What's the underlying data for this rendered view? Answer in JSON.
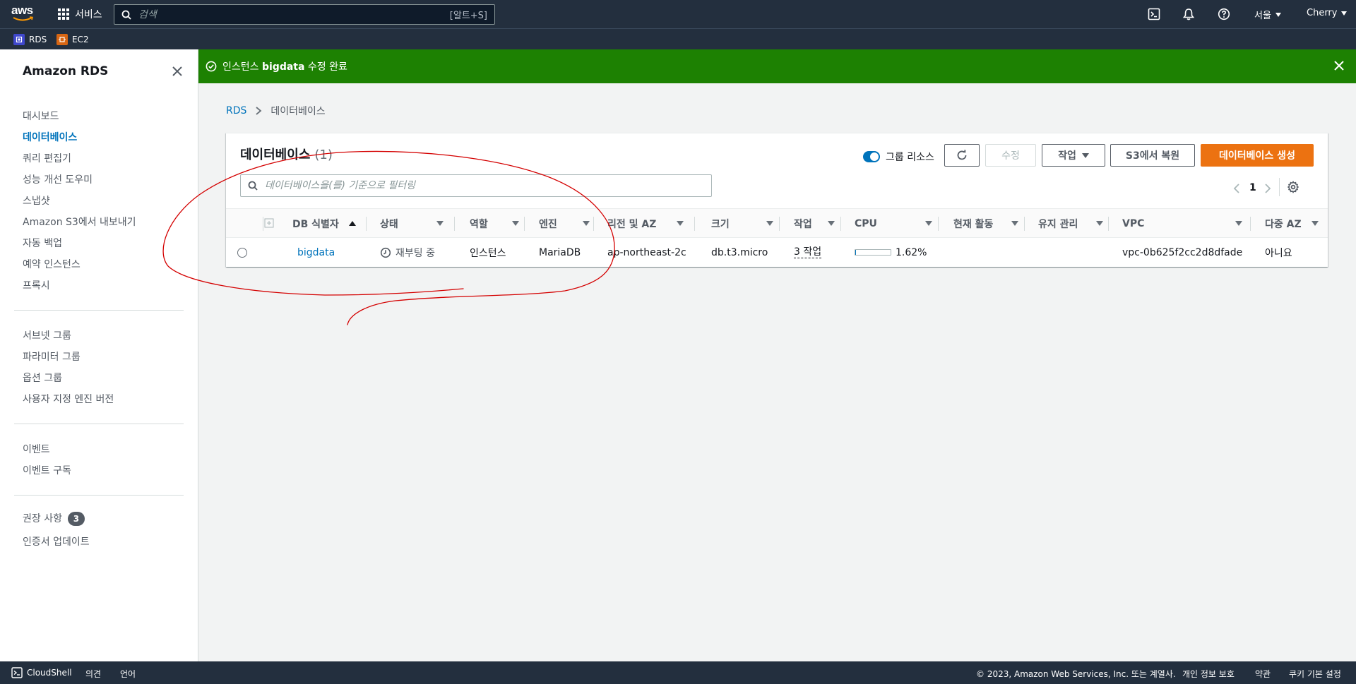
{
  "topnav": {
    "logo_text": "aws",
    "services_label": "서비스",
    "search_placeholder": "검색",
    "search_shortcut": "[알트+S]",
    "region_label": "서울",
    "user_label": "Cherry"
  },
  "favorites": [
    {
      "label": "RDS",
      "color": "#3f48cc"
    },
    {
      "label": "EC2",
      "color": "#d86613"
    }
  ],
  "sidebar": {
    "title": "Amazon RDS",
    "group1": [
      "대시보드",
      "데이터베이스",
      "쿼리 편집기",
      "성능 개선 도우미",
      "스냅샷",
      "Amazon S3에서 내보내기",
      "자동 백업",
      "예약 인스턴스",
      "프록시"
    ],
    "active_item": "데이터베이스",
    "group2": [
      "서브넷 그룹",
      "파라미터 그룹",
      "옵션 그룹",
      "사용자 지정 엔진 버전"
    ],
    "group3": [
      "이벤트",
      "이벤트 구독"
    ],
    "group4": [
      "권장 사항",
      "인증서 업데이트"
    ],
    "recommendations_badge": "3"
  },
  "flash": {
    "prefix": "인스턴스 ",
    "bold": "bigdata",
    "suffix": " 수정 완료",
    "color": "#1d8102"
  },
  "breadcrumb": {
    "root": "RDS",
    "current": "데이터베이스"
  },
  "databases": {
    "title": "데이터베이스",
    "count": "(1)",
    "group_resources_label": "그룹 리소스",
    "modify_label": "수정",
    "actions_label": "작업",
    "restore_s3_label": "S3에서 복원",
    "create_label": "데이터베이스 생성",
    "filter_placeholder": "데이터베이스을(를) 기준으로 필터링",
    "page": "1",
    "columns": [
      "DB 식별자",
      "상태",
      "역할",
      "엔진",
      "리전 및 AZ",
      "크기",
      "작업",
      "CPU",
      "현재 활동",
      "유지 관리",
      "VPC",
      "다중 AZ"
    ],
    "rows": [
      {
        "identifier": "bigdata",
        "status": "재부팅 중",
        "role": "인스턴스",
        "engine": "MariaDB",
        "region_az": "ap-northeast-2c",
        "size": "db.t3.micro",
        "actions": "3 작업",
        "cpu": "1.62%",
        "cpu_fraction": 0.0162,
        "activity": "",
        "maintenance": "",
        "vpc": "vpc-0b625f2cc2d8dfade",
        "multi_az": "아니요"
      }
    ]
  },
  "footer": {
    "cloudshell": "CloudShell",
    "feedback": "의견",
    "language": "언어",
    "copyright": "© 2023, Amazon Web Services, Inc. 또는 계열사.",
    "privacy": "개인 정보 보호",
    "terms": "약관",
    "cookies": "쿠키 기본 설정"
  },
  "colors": {
    "accent": "#0073bb",
    "primary_button": "#ec7211",
    "annotation": "#d40000"
  }
}
